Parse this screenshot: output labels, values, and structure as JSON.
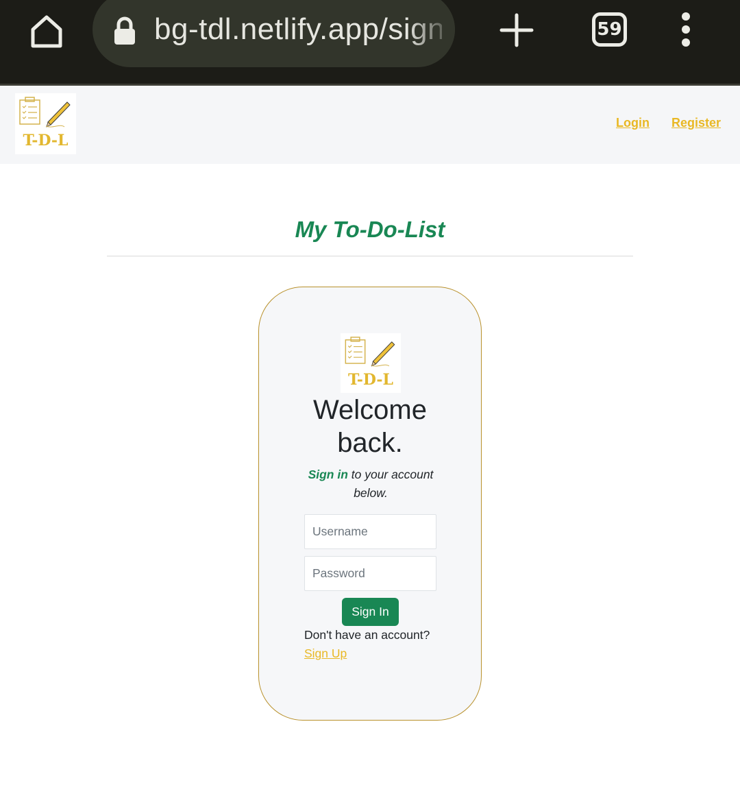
{
  "browser": {
    "url": "bg-tdl.netlify.app/signin",
    "tab_count": "59",
    "icons": [
      "home-icon",
      "lock-icon",
      "plus-icon",
      "tabs-icon",
      "overflow-menu-icon"
    ]
  },
  "navbar": {
    "logo_text": "T-D-L",
    "login_label": "Login",
    "register_label": "Register"
  },
  "page": {
    "title": "My To-Do-List"
  },
  "card": {
    "logo_text": "T-D-L",
    "welcome_line1": "Welcome",
    "welcome_line2": "back.",
    "subtitle_accent": "Sign in",
    "subtitle_rest": " to your account below.",
    "username_placeholder": "Username",
    "password_placeholder": "Password",
    "signin_label": "Sign In",
    "no_account_text": "Don't have an account?",
    "signup_label": "Sign Up"
  },
  "colors": {
    "accent_green": "#198754",
    "accent_gold": "#e9b824",
    "card_border": "#b8902a",
    "chrome_bg": "#1c1c17"
  }
}
